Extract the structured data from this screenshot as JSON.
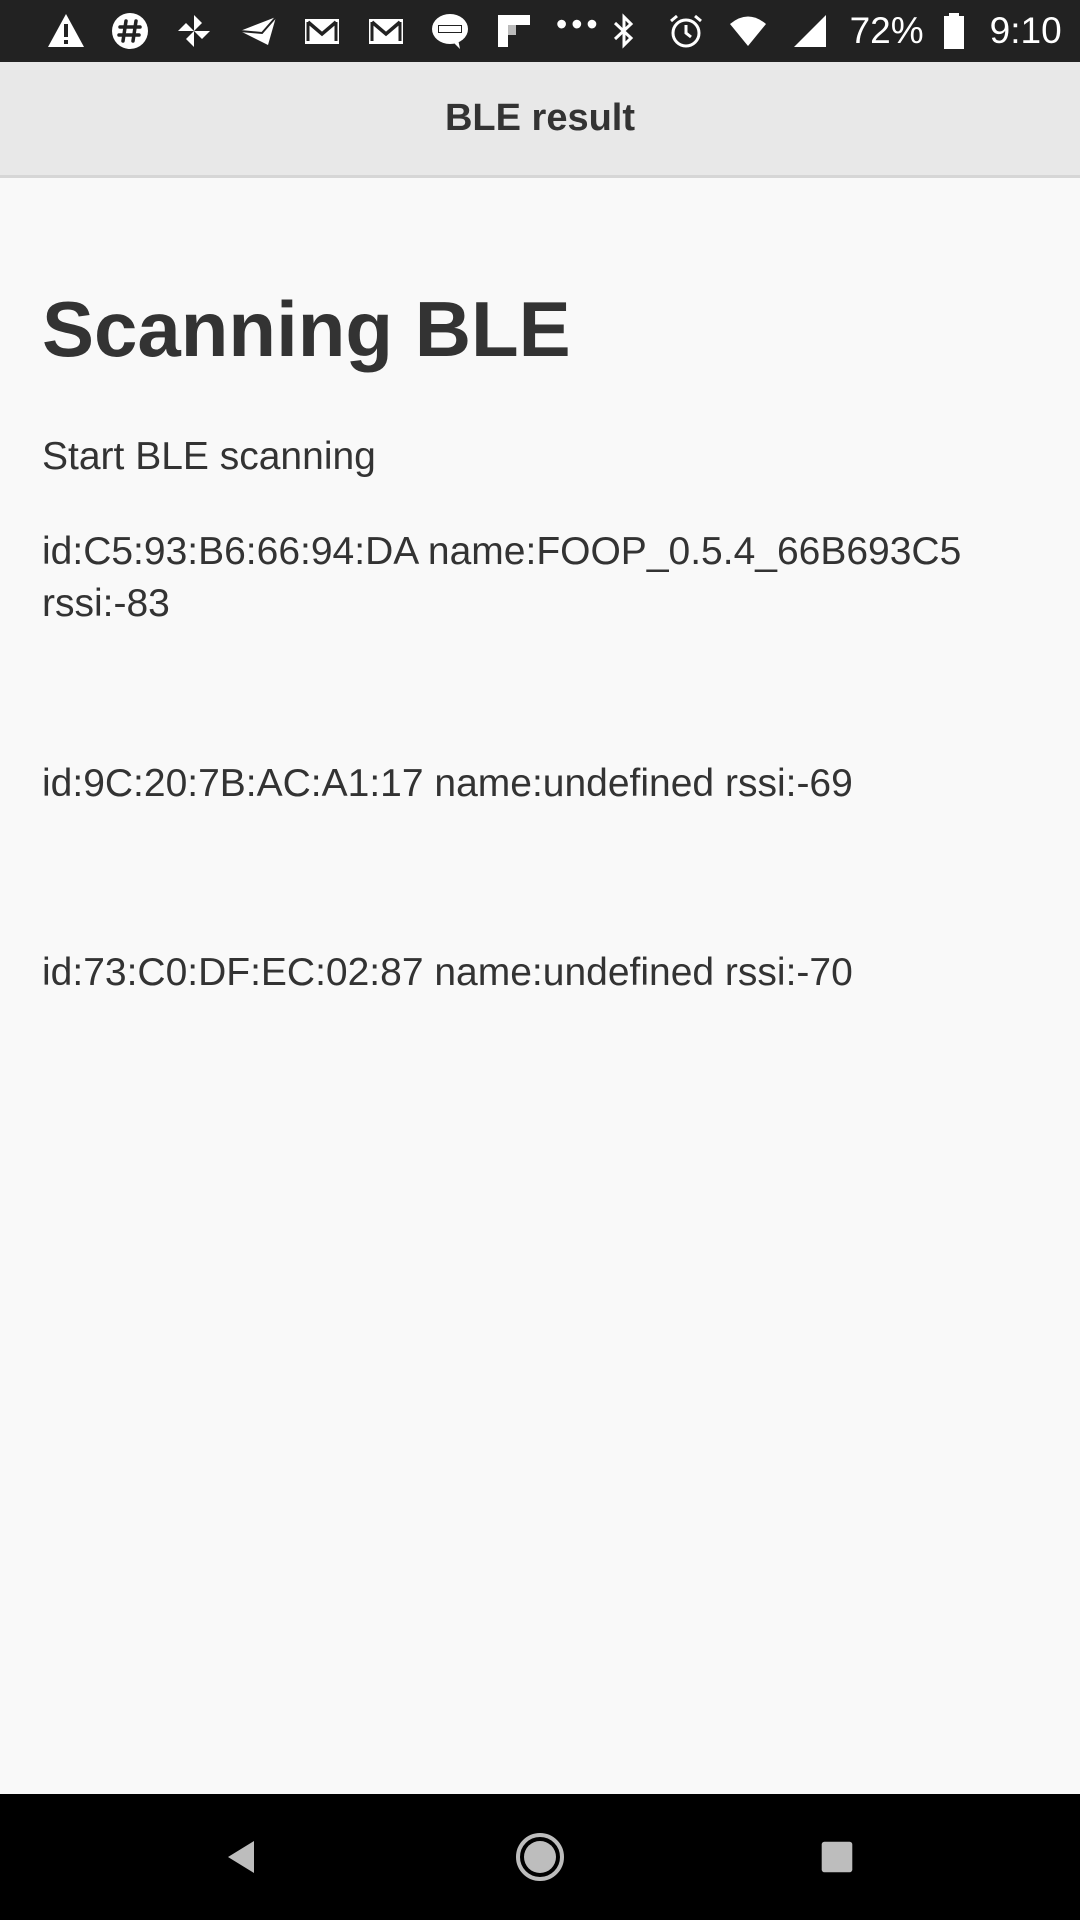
{
  "status_bar": {
    "icons_left": [
      "alert-icon",
      "slack-icon",
      "pinwheel-icon",
      "paper-plane-icon",
      "gmail-icon",
      "gmail-icon",
      "line-icon",
      "flipboard-icon",
      "more-dots-icon"
    ],
    "icons_right": [
      "bluetooth-icon",
      "alarm-icon",
      "wifi-icon",
      "cell-signal-icon",
      "battery-icon"
    ],
    "battery": "72%",
    "time": "9:10",
    "more": "•••"
  },
  "header": {
    "title": "BLE result"
  },
  "main": {
    "title": "Scanning BLE",
    "status": "Start BLE scanning",
    "devices": [
      "id:C5:93:B6:66:94:DA name:FOOP_0.5.4_66B693C5 rssi:-83",
      "id:9C:20:7B:AC:A1:17 name:undefined rssi:-69",
      "id:73:C0:DF:EC:02:87 name:undefined rssi:-70"
    ]
  },
  "colors": {
    "status_bar_bg": "#222222",
    "header_bg": "#e8e8e8",
    "page_bg": "#f9f9f9",
    "text": "#333333",
    "nav_bar_bg": "#000000"
  }
}
